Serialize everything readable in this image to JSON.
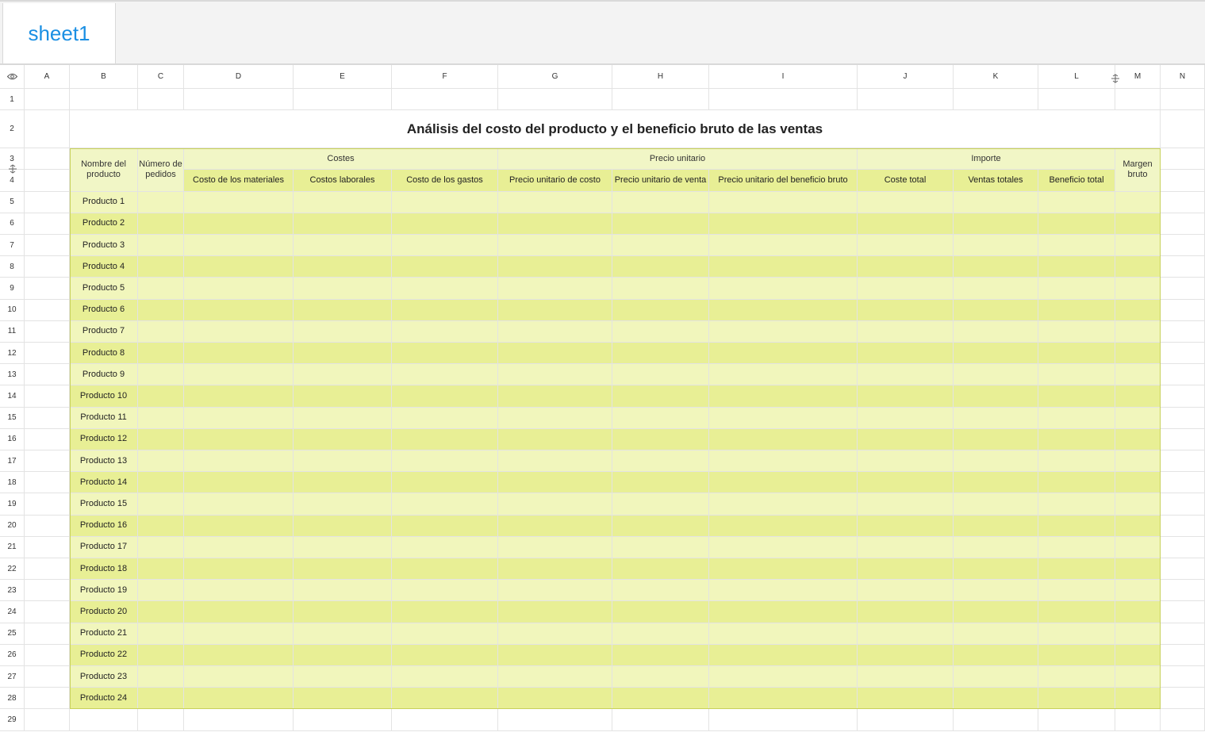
{
  "sheet_tabs": [
    "sheet1"
  ],
  "columns": [
    "A",
    "B",
    "C",
    "D",
    "E",
    "F",
    "G",
    "H",
    "I",
    "J",
    "K",
    "L",
    "M",
    "N"
  ],
  "rows": [
    "1",
    "2",
    "3",
    "4",
    "5",
    "6",
    "7",
    "8",
    "9",
    "10",
    "11",
    "12",
    "13",
    "14",
    "15",
    "16",
    "17",
    "18",
    "19",
    "20",
    "21",
    "22",
    "23",
    "24",
    "25",
    "26",
    "27",
    "28",
    "29"
  ],
  "title": "Análisis del costo del producto y el beneficio bruto de las ventas",
  "group_headers": {
    "nombre": "Nombre del producto",
    "pedidos": "Número de pedidos",
    "costes": "Costes",
    "precio": "Precio unitario",
    "importe": "Importe",
    "margen": "Margen bruto"
  },
  "sub_headers": [
    "Costo de los materiales",
    "Costos laborales",
    "Costo de los gastos",
    "Precio unitario de costo",
    "Precio unitario de venta",
    "Precio unitario del beneficio bruto",
    "Coste total",
    "Ventas totales",
    "Beneficio total"
  ],
  "products": [
    "Producto 1",
    "Producto 2",
    "Producto 3",
    "Producto 4",
    "Producto 5",
    "Producto 6",
    "Producto 7",
    "Producto 8",
    "Producto 9",
    "Producto 10",
    "Producto 11",
    "Producto 12",
    "Producto 13",
    "Producto 14",
    "Producto 15",
    "Producto 16",
    "Producto 17",
    "Producto 18",
    "Producto 19",
    "Producto 20",
    "Producto 21",
    "Producto 22",
    "Producto 23",
    "Producto 24"
  ],
  "colors": {
    "accent": "#1a8fe3",
    "band_light": "#f1f6bc",
    "band_dark": "#e8ef95",
    "header_fill": "#f1f6c6"
  }
}
